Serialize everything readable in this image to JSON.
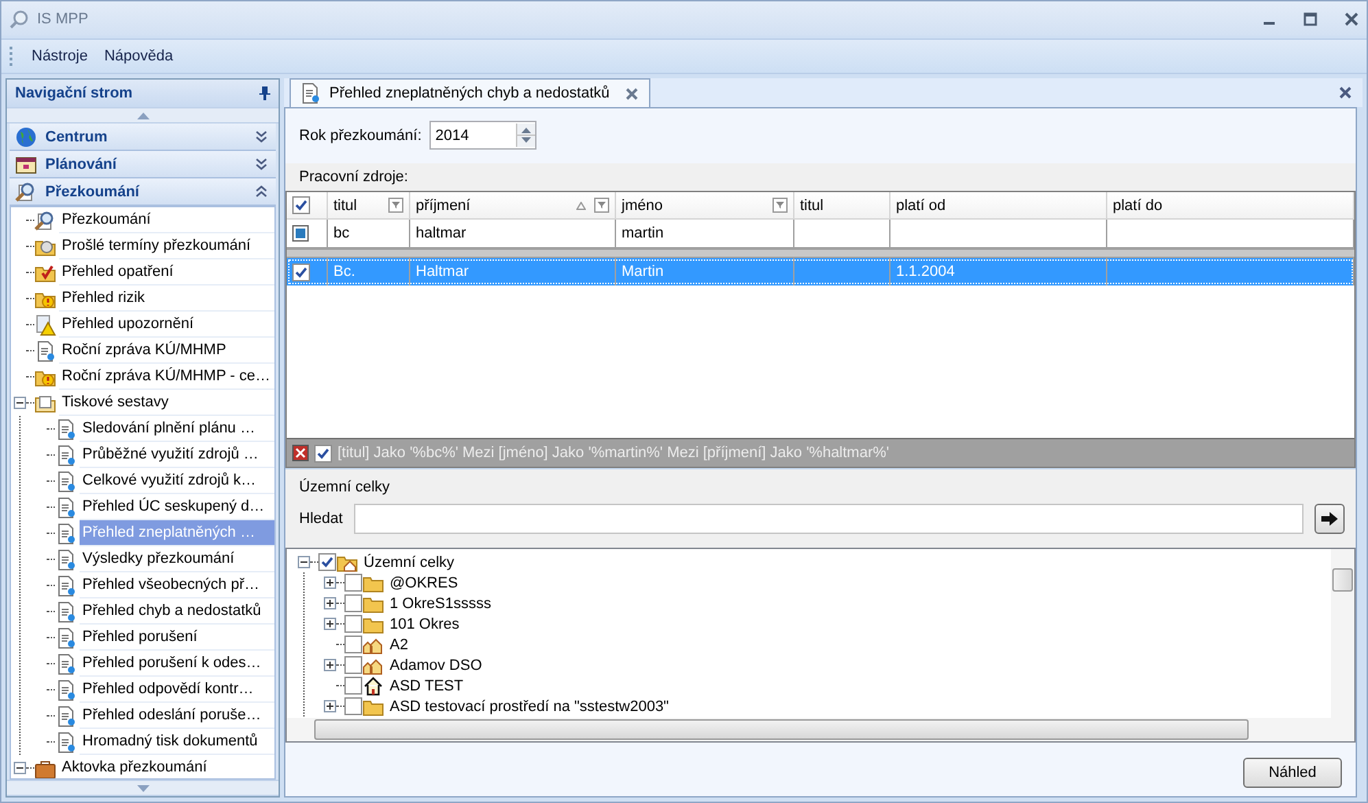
{
  "window": {
    "title": "IS MPP"
  },
  "menu": [
    "Nástroje",
    "Nápověda"
  ],
  "navigation": {
    "title": "Navigační strom",
    "groups": [
      {
        "label": "Centrum",
        "kind": "globe",
        "expanded": false
      },
      {
        "label": "Plánování",
        "kind": "calendar",
        "expanded": false
      },
      {
        "label": "Přezkoumání",
        "kind": "review",
        "expanded": true
      }
    ],
    "tree": [
      {
        "label": "Přezkoumání",
        "kind": "review",
        "selected": false
      },
      {
        "label": "Prošlé termíny přezkoumání",
        "kind": "expired",
        "selected": false
      },
      {
        "label": "Přehled opatření",
        "kind": "measures",
        "selected": false
      },
      {
        "label": "Přehled rizik",
        "kind": "risks",
        "selected": false
      },
      {
        "label": "Přehled upozornění",
        "kind": "warning",
        "selected": false
      },
      {
        "label": "Roční zpráva KÚ/MHMP",
        "kind": "report",
        "selected": false
      },
      {
        "label": "Roční zpráva KÚ/MHMP - ce…",
        "kind": "risks",
        "selected": false
      },
      {
        "label": "Tiskové sestavy",
        "kind": "print",
        "selected": false,
        "expanded": true,
        "children": [
          {
            "label": "Sledování plnění plánu …",
            "kind": "report",
            "selected": false
          },
          {
            "label": "Průběžné využití zdrojů …",
            "kind": "report",
            "selected": false
          },
          {
            "label": "Celkové využití zdrojů k…",
            "kind": "report",
            "selected": false
          },
          {
            "label": "Přehled ÚC seskupený d…",
            "kind": "report",
            "selected": false
          },
          {
            "label": "Přehled zneplatněných …",
            "kind": "report",
            "selected": true
          },
          {
            "label": "Výsledky přezkoumání",
            "kind": "report",
            "selected": false
          },
          {
            "label": "Přehled všeobecných př…",
            "kind": "report",
            "selected": false
          },
          {
            "label": "Přehled chyb a nedostatků",
            "kind": "report",
            "selected": false
          },
          {
            "label": "Přehled porušení",
            "kind": "report",
            "selected": false
          },
          {
            "label": "Přehled porušení k odes…",
            "kind": "report",
            "selected": false
          },
          {
            "label": "Přehled odpovědí kontr…",
            "kind": "report",
            "selected": false
          },
          {
            "label": "Přehled odeslání poruše…",
            "kind": "report",
            "selected": false
          },
          {
            "label": "Hromadný tisk dokumentů",
            "kind": "report",
            "selected": false
          }
        ]
      },
      {
        "label": "Aktovka přezkoumání",
        "kind": "briefcase",
        "selected": false,
        "expanded": true
      }
    ]
  },
  "tab": {
    "label": "Přehled zneplatněných chyb a nedostatků",
    "selected": true
  },
  "year": {
    "label": "Rok přezkoumání:",
    "value": "2014"
  },
  "resources": {
    "label": "Pracovní zdroje:",
    "header_checked": true,
    "columns": [
      {
        "label": "titul",
        "filter": true,
        "sorted": false,
        "filter_text": "bc",
        "values": [
          "Bc."
        ]
      },
      {
        "label": "příjmení",
        "filter": true,
        "sorted": true,
        "filter_text": "haltmar",
        "values": [
          "Haltmar"
        ]
      },
      {
        "label": "jméno",
        "filter": true,
        "sorted": false,
        "filter_text": "martin",
        "values": [
          "Martin"
        ]
      },
      {
        "label": "titul",
        "filter": false,
        "sorted": false
      },
      {
        "label": "platí od",
        "filter": false,
        "sorted": false,
        "values": [
          "1.1.2004"
        ]
      },
      {
        "label": "platí do",
        "filter": false,
        "sorted": false
      }
    ],
    "rows": [
      {
        "selected": true,
        "checked": true
      }
    ],
    "filter_bar": {
      "enabled": true,
      "text": "[titul] Jako '%bc%' Mezi [jméno] Jako '%martin%' Mezi [příjmení] Jako '%haltmar%'"
    }
  },
  "units": {
    "title": "Územní celky",
    "search_label": "Hledat",
    "tree": [
      {
        "label": "Územní celky",
        "kind": "root",
        "checked": true,
        "expanded": true,
        "children": [
          {
            "label": "@OKRES",
            "kind": "folder",
            "checked": false,
            "expanded": false
          },
          {
            "label": "1 OkreS1sssss",
            "kind": "folder",
            "checked": false,
            "expanded": false
          },
          {
            "label": "101 Okres",
            "kind": "folder",
            "checked": false,
            "expanded": false
          },
          {
            "label": "A2",
            "kind": "town",
            "checked": false
          },
          {
            "label": "Adamov DSO",
            "kind": "town",
            "checked": false,
            "expanded": false
          },
          {
            "label": "ASD TEST",
            "kind": "house",
            "checked": false
          },
          {
            "label": "ASD testovací prostředí na \"sstestw2003\"",
            "kind": "folder",
            "checked": false,
            "expanded": false
          }
        ]
      }
    ]
  },
  "buttons": [
    "Náhled"
  ]
}
